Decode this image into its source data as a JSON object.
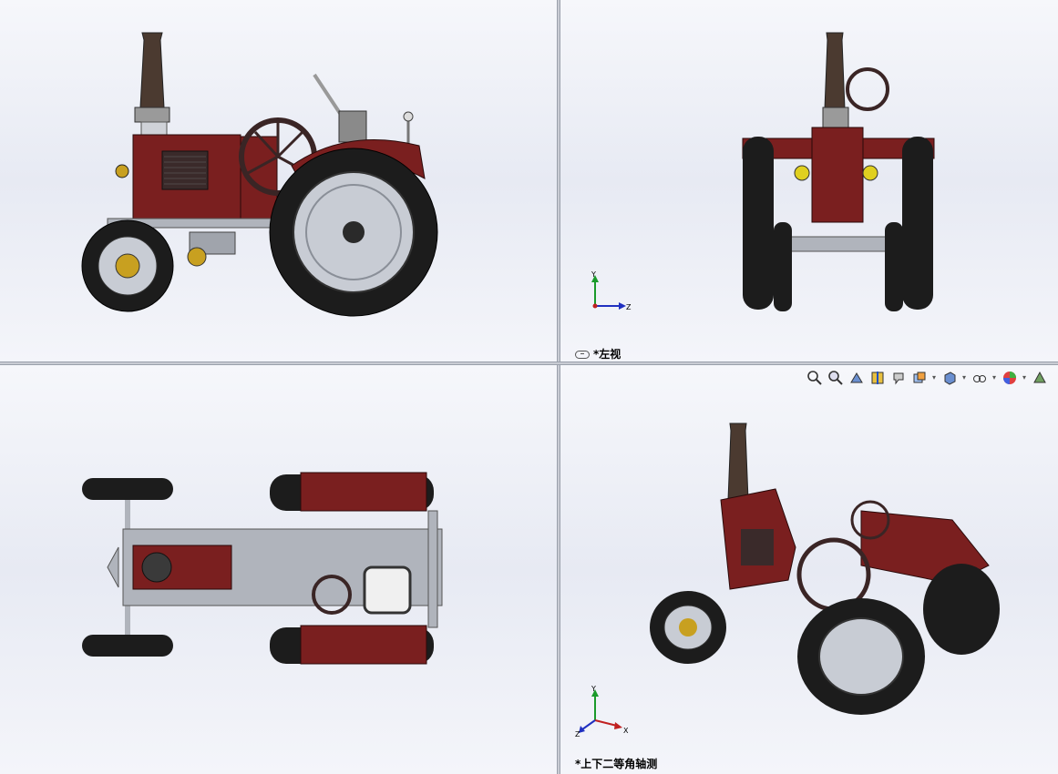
{
  "viewports": {
    "top_left": {
      "name": "right-view"
    },
    "top_right": {
      "label": "*左视"
    },
    "bottom_left": {
      "name": "bottom-view"
    },
    "bottom_right": {
      "label": "*上下二等角轴测"
    }
  },
  "triad": {
    "x": "X",
    "y": "Y",
    "z": "Z"
  },
  "toolbar": {
    "icons": [
      "zoom-to-fit-icon",
      "zoom-to-area-icon",
      "previous-view-icon",
      "section-view-icon",
      "dynamic-annotation-icon",
      "view-orientation-icon",
      "display-style-icon",
      "hide-show-items-icon",
      "edit-appearance-icon",
      "apply-scene-icon"
    ]
  },
  "colors": {
    "body_red": "#7a1f1f",
    "tire_black": "#1c1c1c",
    "rim_silver": "#c8ccd4",
    "chimney_brown": "#4b3a30",
    "lamp_yellow": "#e0d020",
    "frame_gray": "#b0b4bc",
    "viewport_bg": "#eef0f6"
  }
}
